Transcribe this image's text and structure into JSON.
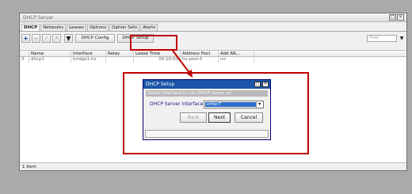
{
  "window": {
    "title": "DHCP Server"
  },
  "tabs": [
    "DHCP",
    "Networks",
    "Leases",
    "Options",
    "Option Sets",
    "Alerts"
  ],
  "toolbar": {
    "dhcp_config_label": "DHCP Config",
    "dhcp_setup_label": "DHCP Setup",
    "find_placeholder": "Find"
  },
  "table": {
    "headers": [
      "",
      "Name",
      "Interface",
      "Relay",
      "Lease Time",
      "Address Pool",
      "Add AR..."
    ],
    "rows": [
      {
        "flag": "X",
        "name": "dhcp1",
        "interface": "bridge1-hs",
        "relay": "",
        "lease_time": "00:10:00",
        "address_pool": "hs-pool-5",
        "add_arp": "no"
      }
    ]
  },
  "status_bar": {
    "text": "1 item"
  },
  "dialog": {
    "title": "DHCP Setup",
    "subtitle": "Select interface to run DHCP server on",
    "field_label": "DHCP Server Interface:",
    "field_value": "ether7",
    "back_label": "Back",
    "next_label": "Next",
    "cancel_label": "Cancel"
  },
  "colors": {
    "highlight": "#c00000",
    "dialog_title": "#1b55a8"
  }
}
